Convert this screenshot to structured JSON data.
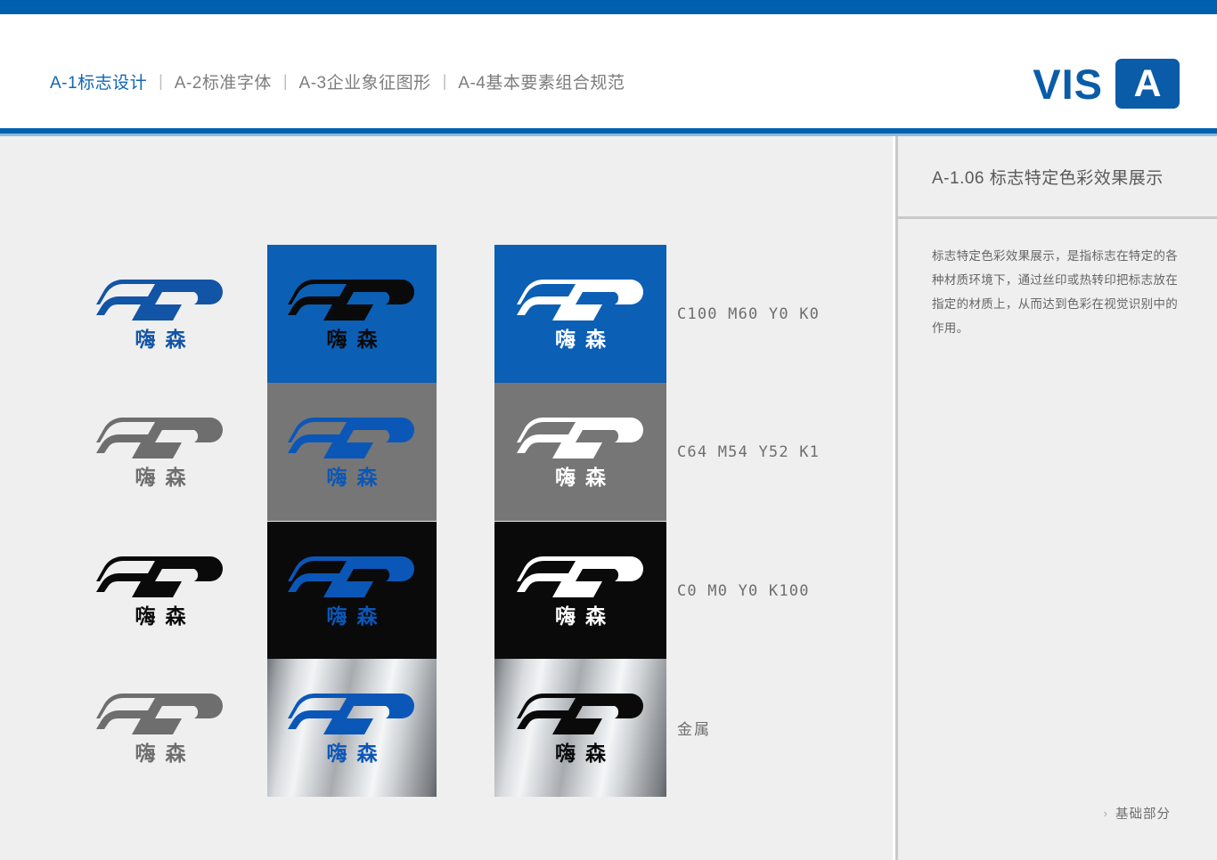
{
  "header": {
    "nav_items": [
      {
        "label": "A-1标志设计",
        "active": true
      },
      {
        "label": "A-2标准字体",
        "active": false
      },
      {
        "label": "A-3企业象征图形",
        "active": false
      },
      {
        "label": "A-4基本要素组合规范",
        "active": false
      }
    ],
    "separator": "|",
    "logo": {
      "word": "VIS",
      "badge_letter": "A"
    },
    "bar_color": "#0060b0"
  },
  "sidebar": {
    "section_code": "A-1.06",
    "section_title": "标志特定色彩效果展示",
    "title_full": "A-1.06  标志特定色彩效果展示",
    "description": "标志特定色彩效果展示，是指标志在特定的各种材质环境下，通过丝印或热转印把标志放在指定的材质上，从而达到色彩在视觉识别中的作用。",
    "footer_marker": "›",
    "footer_label": "基础部分"
  },
  "brand": {
    "wordmark": "嗨森",
    "primary_blue": "#1254a6",
    "swatch_blue": "#0b5fb5",
    "swatch_gray": "#767676",
    "swatch_black": "#0a0a0a"
  },
  "grid": {
    "rows": [
      {
        "label": "C100 M60 Y0 K0",
        "label_kind": "cmyk",
        "cells": [
          {
            "bg": "plain",
            "logo": "blue"
          },
          {
            "bg": "blue",
            "logo": "black"
          },
          {
            "bg": "blue",
            "logo": "white"
          }
        ]
      },
      {
        "label": "C64 M54 Y52 K1",
        "label_kind": "cmyk",
        "cells": [
          {
            "bg": "plain",
            "logo": "gray"
          },
          {
            "bg": "gray",
            "logo": "brightblue"
          },
          {
            "bg": "gray",
            "logo": "white"
          }
        ]
      },
      {
        "label": "C0 M0 Y0 K100",
        "label_kind": "cmyk",
        "cells": [
          {
            "bg": "plain",
            "logo": "black"
          },
          {
            "bg": "black",
            "logo": "brightblue"
          },
          {
            "bg": "black",
            "logo": "white"
          }
        ]
      },
      {
        "label": "金属",
        "label_kind": "text",
        "cells": [
          {
            "bg": "plain",
            "logo": "gray"
          },
          {
            "bg": "metal",
            "logo": "brightblue"
          },
          {
            "bg": "metal",
            "logo": "black"
          }
        ]
      }
    ]
  }
}
